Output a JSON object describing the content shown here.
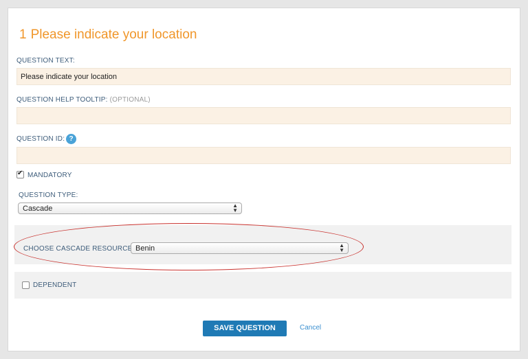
{
  "question": {
    "number": "1",
    "title": "Please indicate your location"
  },
  "question_text": {
    "label": "QUESTION TEXT:",
    "value": "Please indicate your location"
  },
  "help_tooltip": {
    "label": "QUESTION HELP TOOLTIP:",
    "optional": "(OPTIONAL)",
    "value": ""
  },
  "question_id": {
    "label": "QUESTION ID:",
    "help_glyph": "?",
    "value": ""
  },
  "mandatory": {
    "label": "MANDATORY",
    "checked": true
  },
  "question_type": {
    "label": "QUESTION TYPE:",
    "selected": "Cascade"
  },
  "cascade": {
    "label": "CHOOSE CASCADE RESOURCE:",
    "selected": "Benin"
  },
  "dependent": {
    "label": "DEPENDENT",
    "checked": false
  },
  "actions": {
    "save_label": "SAVE QUESTION",
    "cancel_label": "Cancel"
  },
  "colors": {
    "accent": "#f0962a",
    "primary_button": "#1f7ab5",
    "link": "#3a8fd0",
    "highlight_oval": "#c8302c",
    "input_bg": "#fbf1e4"
  },
  "icons": {
    "help": "help-icon",
    "select_arrows": "updown-arrows-icon"
  }
}
